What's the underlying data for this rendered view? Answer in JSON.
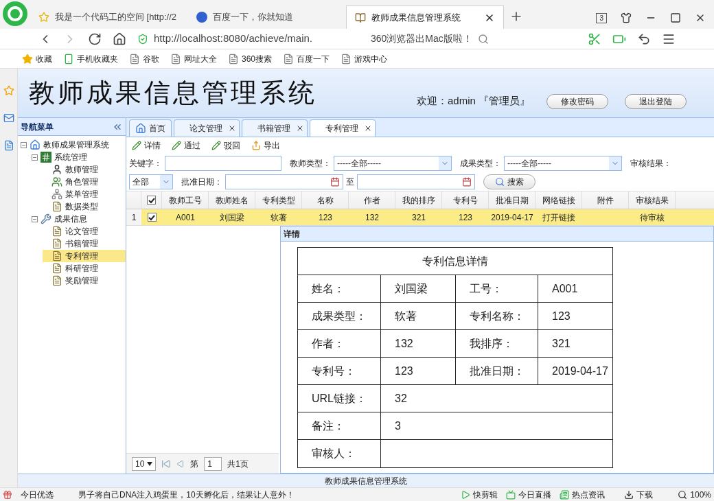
{
  "browser": {
    "tabs": [
      {
        "title": "我是一个代码工的空间 [http://2",
        "selected": false
      },
      {
        "title": "百度一下，你就知道",
        "selected": false
      },
      {
        "title": "教师成果信息管理系统",
        "selected": true
      }
    ],
    "tab_count": "3",
    "url": "http://localhost:8080/achieve/main.",
    "search_hint": "360浏览器出Mac版啦！",
    "bookmarks": [
      "收藏",
      "手机收藏夹",
      "谷歌",
      "网址大全",
      "360搜索",
      "百度一下",
      "游戏中心"
    ]
  },
  "header": {
    "title": "教师成果信息管理系统",
    "welcome": "欢迎：admin 『管理员』",
    "buttons": [
      "修改密码",
      "退出登陆"
    ]
  },
  "nav": {
    "title": "导航菜单",
    "tree": [
      {
        "label": "教师成果管理系统",
        "kind": "home",
        "expanded": true,
        "selected": false,
        "children": [
          {
            "label": "系统管理",
            "kind": "module",
            "expanded": true,
            "selected": false,
            "children": [
              {
                "label": "教师管理",
                "kind": "user",
                "selected": false
              },
              {
                "label": "角色管理",
                "kind": "role",
                "selected": false
              },
              {
                "label": "菜单管理",
                "kind": "menu",
                "selected": false
              },
              {
                "label": "数据类型",
                "kind": "doc",
                "selected": false
              }
            ]
          },
          {
            "label": "成果信息",
            "kind": "tool",
            "expanded": true,
            "selected": false,
            "children": [
              {
                "label": "论文管理",
                "kind": "doc",
                "selected": false
              },
              {
                "label": "书籍管理",
                "kind": "doc",
                "selected": false
              },
              {
                "label": "专利管理",
                "kind": "doc",
                "selected": true
              },
              {
                "label": "科研管理",
                "kind": "doc",
                "selected": false
              },
              {
                "label": "奖励管理",
                "kind": "doc",
                "selected": false
              }
            ]
          }
        ]
      }
    ]
  },
  "main": {
    "tabs": [
      {
        "label": "首页",
        "selected": false,
        "closable": false
      },
      {
        "label": "论文管理",
        "selected": false,
        "closable": true
      },
      {
        "label": "书籍管理",
        "selected": false,
        "closable": true
      },
      {
        "label": "专利管理",
        "selected": true,
        "closable": true
      }
    ],
    "toolbar": [
      {
        "label": "详情",
        "kind": "edit"
      },
      {
        "label": "通过",
        "kind": "edit"
      },
      {
        "label": "驳回",
        "kind": "edit"
      },
      {
        "label": "导出",
        "kind": "export"
      }
    ],
    "filters": {
      "keyword_label": "关键字：",
      "teacher_type_label": "教师类型：",
      "teacher_type_value": "-----全部-----",
      "result_type_label": "成果类型：",
      "result_type_value": "-----全部-----",
      "review_label": "审核结果：",
      "review_value": "全部",
      "date_label": "批准日期：",
      "date_to": "至",
      "search_button": "搜索"
    },
    "grid": {
      "columns": [
        "教师工号",
        "教师姓名",
        "专利类型",
        "名称",
        "作者",
        "我的排序",
        "专利号",
        "批准日期",
        "网络链接",
        "附件",
        "审核结果"
      ],
      "header_checked": true,
      "rows": [
        {
          "number": "1",
          "checked": true,
          "selected": true,
          "cells": [
            "A001",
            "刘国梁",
            "软著",
            "123",
            "132",
            "321",
            "123",
            "2019-04-17",
            "打开链接",
            "",
            "待审核"
          ]
        }
      ]
    },
    "pager": {
      "page_size": "10",
      "page_label": "第",
      "page": "1",
      "total": "共1页"
    },
    "dialog": {
      "title": "详情",
      "heading": "专利信息详情",
      "rows": [
        [
          {
            "label": "姓名：",
            "value": "刘国梁"
          },
          {
            "label": "工号：",
            "value": "A001"
          }
        ],
        [
          {
            "label": "成果类型：",
            "value": "软著"
          },
          {
            "label": "专利名称：",
            "value": "123"
          }
        ],
        [
          {
            "label": "作者：",
            "value": "132"
          },
          {
            "label": "我排序：",
            "value": "321"
          }
        ],
        [
          {
            "label": "专利号：",
            "value": "123"
          },
          {
            "label": "批准日期：",
            "value": "2019-04-17"
          }
        ],
        [
          {
            "label": "URL链接：",
            "value": "32"
          }
        ],
        [
          {
            "label": "备注：",
            "value": "3"
          }
        ],
        [
          {
            "label": "审核人："
          }
        ]
      ]
    }
  },
  "footer": "教师成果信息管理系统",
  "status_bar": {
    "promo": "今日优选",
    "news": "男子将自己DNA注入鸡蛋里，10天孵化后，结果让人意外！",
    "items": [
      "快剪辑",
      "今日直播",
      "热点资讯"
    ],
    "download": "下载",
    "zoom": "100%"
  }
}
